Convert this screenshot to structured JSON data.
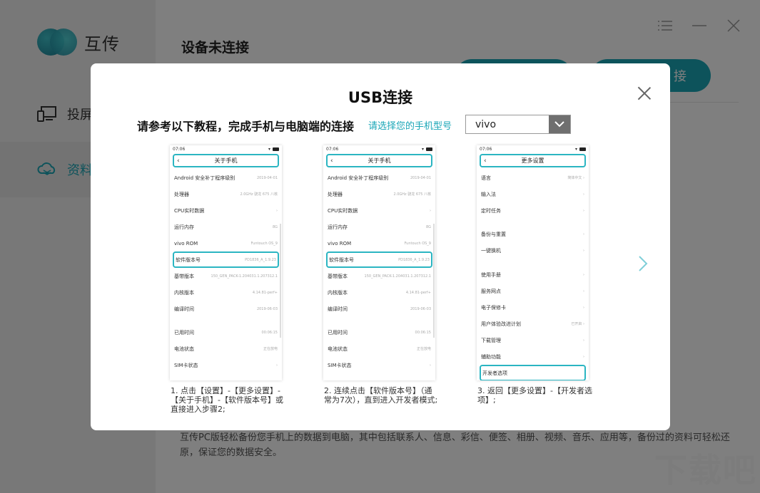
{
  "app": {
    "name": "互传",
    "main_title": "设备未连接",
    "pill_1": "",
    "pill_2": "接",
    "description": "互传PC版轻松备份您手机上的数据到电脑，其中包括联系人、信息、彩信、便签、相册、视频、音乐、应用等，备份过的资料可轻松还原，保证您的数据安全。",
    "watermark": "下载吧"
  },
  "sidebar": {
    "items": [
      {
        "label": "投屏",
        "icon": "monitor-phone-icon"
      },
      {
        "label": "资料",
        "icon": "cloud-layers-icon"
      }
    ]
  },
  "window_controls": [
    {
      "name": "menu",
      "icon": "menu-icon"
    },
    {
      "name": "minimize",
      "icon": "minimize-icon"
    },
    {
      "name": "close",
      "icon": "close-icon"
    }
  ],
  "modal": {
    "title": "USB连接",
    "instruction": "请参考以下教程，完成手机与电脑端的连接",
    "model_label": "请选择您的手机型号",
    "model_value": "vivo",
    "accent": "#1aa6b7"
  },
  "phones": [
    {
      "time": "07:06",
      "header": "关于手机",
      "rows": [
        {
          "label": "Android 安全补丁程序级别",
          "value": "2019-04-01"
        },
        {
          "label": "处理器",
          "value": "2.0GHz 骁龙 675 八核"
        },
        {
          "label": "CPU实时数据",
          "value": "›"
        },
        {
          "label": "运行内存",
          "value": "8G"
        },
        {
          "label": "vivo ROM",
          "value": "Funtouch OS_9"
        },
        {
          "label": "软件版本号",
          "value": "PD1836_A_1.9.23"
        },
        {
          "label": "基带版本",
          "value": "150_GEN_PACK-1.204031.1.207312.1"
        },
        {
          "label": "内核版本",
          "value": "4.14.81-perf+"
        },
        {
          "label": "编译时间",
          "value": "2019-06-03"
        },
        {
          "label": "已用时间",
          "value": "00:06:15"
        },
        {
          "label": "电池状态",
          "value": "正在放电"
        },
        {
          "label": "SIM卡状态",
          "value": "›"
        }
      ],
      "caption": "1. 点击【设置】-【更多设置】-【关于手机】-【软件版本号】或直接进入步骤2;"
    },
    {
      "time": "07:06",
      "header": "关于手机",
      "rows": [
        {
          "label": "Android 安全补丁程序级别",
          "value": "2019-04-01"
        },
        {
          "label": "处理器",
          "value": "2.0GHz 骁龙 675 八核"
        },
        {
          "label": "CPU实时数据",
          "value": "›"
        },
        {
          "label": "运行内存",
          "value": "8G"
        },
        {
          "label": "vivo ROM",
          "value": "Funtouch OS_9"
        },
        {
          "label": "软件版本号",
          "value": "PD1836_A_1.9.23"
        },
        {
          "label": "基带版本",
          "value": "150_GEN_PACK-1.204031.1.207312.1"
        },
        {
          "label": "内核版本",
          "value": "4.14.81-perf+"
        },
        {
          "label": "编译时间",
          "value": "2019-06-03"
        },
        {
          "label": "已用时间",
          "value": "00:06:15"
        },
        {
          "label": "电池状态",
          "value": "正在放电"
        },
        {
          "label": "SIM卡状态",
          "value": "›"
        }
      ],
      "caption": "2. 连续点击【软件版本号】（通常为7次），直到进入开发者模式;"
    },
    {
      "time": "07:06",
      "header": "更多设置",
      "rows": [
        {
          "label": "语言",
          "value": "简体中文 ›"
        },
        {
          "label": "输入法",
          "value": "›"
        },
        {
          "label": "定时任务",
          "value": "›"
        },
        {
          "label": "备份与重置",
          "value": "›"
        },
        {
          "label": "一键换机",
          "value": "›"
        },
        {
          "label": "使用手册",
          "value": "›"
        },
        {
          "label": "服务网点",
          "value": "›"
        },
        {
          "label": "电子保修卡",
          "value": "›"
        },
        {
          "label": "用户体验改进计划",
          "value": "已开启 ›"
        },
        {
          "label": "下载管理",
          "value": "›"
        },
        {
          "label": "辅助功能",
          "value": "›"
        },
        {
          "label": "开发者选项",
          "value": ""
        }
      ],
      "caption": "3. 返回【更多设置】-【开发者选项】;"
    }
  ]
}
